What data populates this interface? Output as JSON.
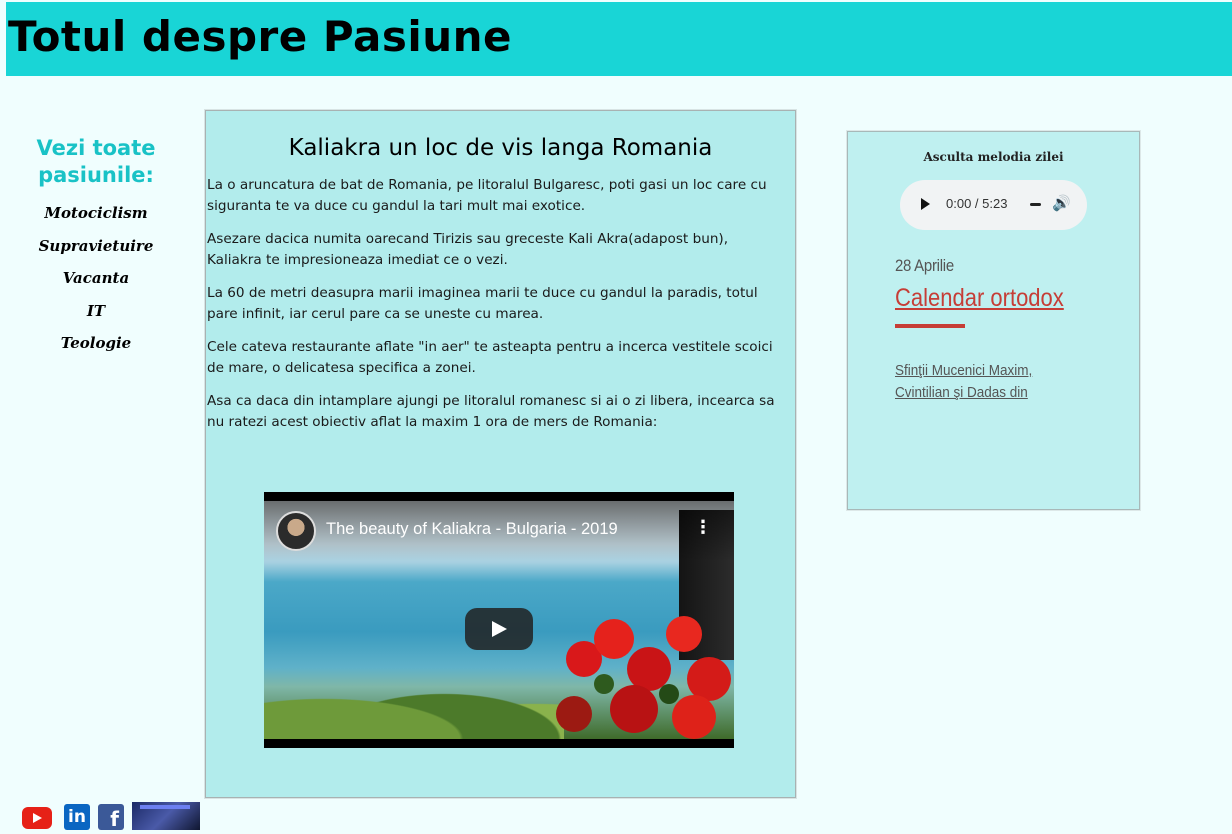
{
  "header": {
    "title": "Totul despre Pasiune"
  },
  "sidebar": {
    "heading": "Vezi toate pasiunile:",
    "items": [
      {
        "label": "Motociclism"
      },
      {
        "label": "Supravietuire"
      },
      {
        "label": "Vacanta"
      },
      {
        "label": "IT"
      },
      {
        "label": "Teologie"
      }
    ]
  },
  "article": {
    "title": "Kaliakra un loc de vis langa Romania",
    "paragraphs": [
      "La o aruncatura de bat de Romania, pe litoralul Bulgaresc, poti gasi un loc care cu siguranta te va duce cu gandul la tari mult mai exotice.",
      "Asezare dacica numita oarecand Tirizis sau greceste Kali Akra(adapost bun), Kaliakra te impresioneaza imediat ce o vezi.",
      "La 60 de metri deasupra marii imaginea marii te duce cu gandul la paradis, totul pare infinit, iar cerul pare ca se uneste cu marea.",
      "Cele cateva restaurante aflate \"in aer\" te asteapta pentru a incerca vestitele scoici de mare, o delicatesa specifica a zonei.",
      "Asa ca daca din intamplare ajungi pe litoralul romanesc si ai o zi libera, incearca sa nu ratezi acest obiectiv aflat la maxim 1 ora de mers de Romania:"
    ],
    "video": {
      "title": "The beauty of Kaliakra - Bulgaria - 2019",
      "menu_icon": "more-vert-icon",
      "play_icon": "play-icon"
    }
  },
  "music": {
    "heading": "Asculta melodia zilei",
    "time": "0:00 / 5:23",
    "volume_icon": "volume-icon"
  },
  "calendar": {
    "date": "28 Aprilie",
    "title": "Calendar ortodox",
    "saint": "Sfinţii Mucenici Maxim, Cvintilian şi Dadas din Ozovia"
  },
  "social": {
    "icons": [
      "youtube-icon",
      "linkedin-icon",
      "facebook-icon",
      "banner-thumbnail"
    ],
    "linkedin_text": "in",
    "facebook_text": "f"
  }
}
